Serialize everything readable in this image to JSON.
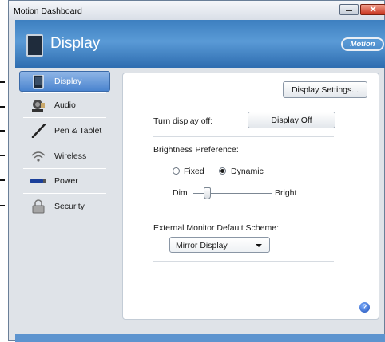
{
  "window": {
    "title": "Motion Dashboard"
  },
  "header": {
    "title": "Display",
    "logo_text": "Motion"
  },
  "sidebar": {
    "items": [
      {
        "label": "Display",
        "icon": "tablet-display-icon",
        "active": true
      },
      {
        "label": "Audio",
        "icon": "speaker-icon",
        "active": false
      },
      {
        "label": "Pen & Tablet",
        "icon": "pen-icon",
        "active": false
      },
      {
        "label": "Wireless",
        "icon": "wireless-icon",
        "active": false
      },
      {
        "label": "Power",
        "icon": "battery-icon",
        "active": false
      },
      {
        "label": "Security",
        "icon": "lock-icon",
        "active": false
      }
    ]
  },
  "panel": {
    "display_settings_button": "Display Settings...",
    "turn_off_label": "Turn display off:",
    "display_off_button": "Display Off",
    "brightness_label": "Brightness Preference:",
    "radio_fixed": "Fixed",
    "radio_dynamic": "Dynamic",
    "selected_brightness": "Dynamic",
    "slider_min_label": "Dim",
    "slider_max_label": "Bright",
    "slider_value_fraction": 0.17,
    "external_label": "External Monitor Default Scheme:",
    "external_selected": "Mirror Display",
    "help_glyph": "?"
  },
  "colors": {
    "header_blue": "#3d7fc0",
    "active_item": "#4a84cf",
    "close_red": "#c8321d"
  }
}
